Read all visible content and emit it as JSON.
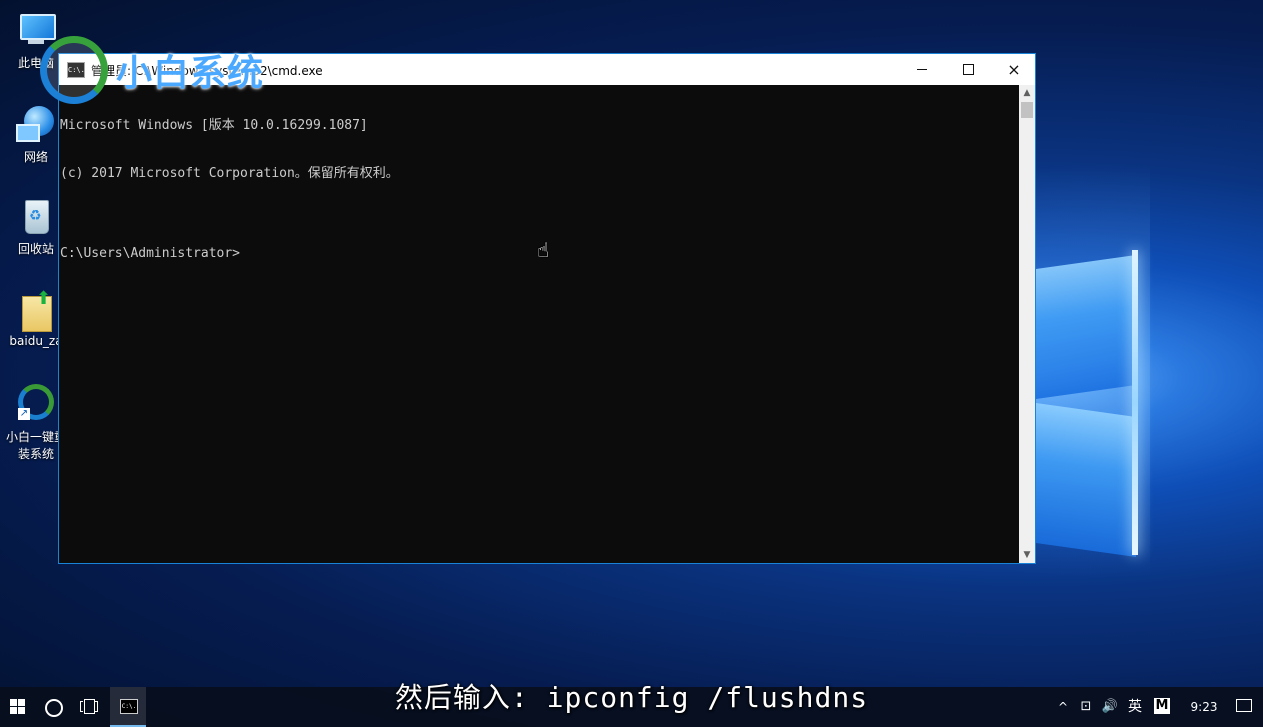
{
  "desktop": {
    "icons": [
      {
        "label": "此电脑",
        "icon": "this-pc-icon"
      },
      {
        "label": "网络",
        "icon": "network-icon"
      },
      {
        "label": "回收站",
        "icon": "recycle-bin-icon"
      },
      {
        "label": "baidu_za",
        "icon": "zip-file-icon"
      },
      {
        "label": "小白一键重装系统",
        "icon": "xiaobai-icon"
      }
    ]
  },
  "watermark": {
    "text": "小白系统",
    "icon": "xiaobai-logo-icon"
  },
  "cmd_window": {
    "title": "管理员: C:\\Windows\\system32\\cmd.exe",
    "icon_text": "C:\\.",
    "controls": {
      "minimize": "minimize-icon",
      "maximize": "maximize-icon",
      "close": "×"
    },
    "console_lines": [
      "Microsoft Windows [版本 10.0.16299.1087]",
      "(c) 2017 Microsoft Corporation。保留所有权利。",
      "",
      "C:\\Users\\Administrator>"
    ]
  },
  "subtitle": "然后输入: ipconfig /flushdns",
  "taskbar": {
    "start": "windows-start-icon",
    "search": "cortana-icon",
    "task_view": "task-view-icon",
    "pinned_app": "cmd-taskbar-icon",
    "tray": {
      "chevron": "^",
      "network_glyph": "⊡",
      "volume_glyph": "🔊",
      "ime": "英",
      "ime_mode": "M",
      "clock": "9:23",
      "notifications": "action-center-icon"
    }
  }
}
